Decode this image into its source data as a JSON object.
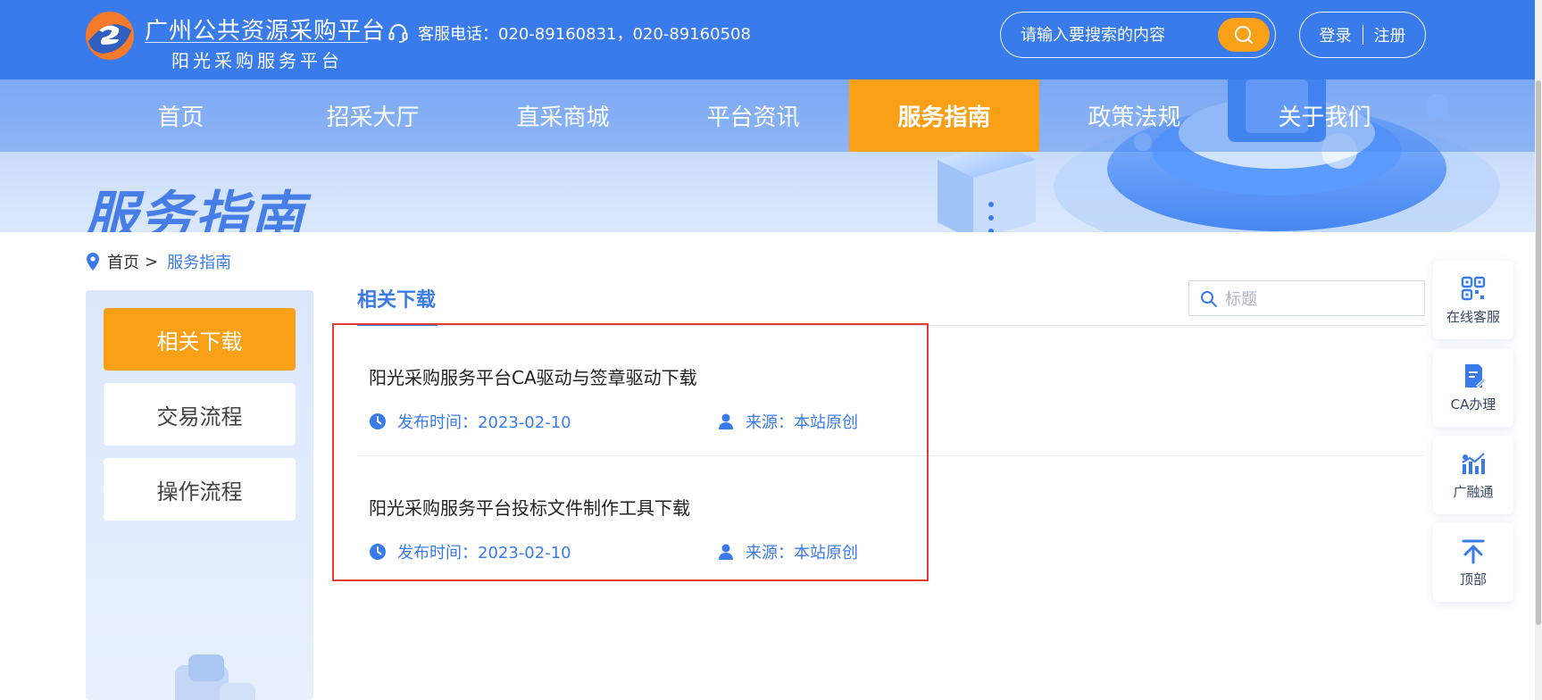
{
  "header": {
    "logo_title": "广州公共资源采购平台",
    "logo_subtitle": "阳光采购服务平台",
    "phone_label": "客服电话：020-89160831，020-89160508",
    "search_placeholder": "请输入要搜索的内容",
    "login": "登录",
    "register": "注册"
  },
  "nav": {
    "items": [
      "首页",
      "招采大厅",
      "直采商城",
      "平台资讯",
      "服务指南",
      "政策法规",
      "关于我们"
    ],
    "active_index": 4
  },
  "banner": {
    "title": "服务指南"
  },
  "breadcrumb": {
    "home": "首页",
    "separator": ">",
    "current": "服务指南"
  },
  "sidebar": {
    "items": [
      "相关下载",
      "交易流程",
      "操作流程"
    ],
    "active_index": 0
  },
  "content": {
    "tab_title": "相关下载",
    "filter_placeholder": "标题",
    "items": [
      {
        "title": "阳光采购服务平台CA驱动与签章驱动下载",
        "date": "发布时间：2023-02-10",
        "source": "来源：本站原创"
      },
      {
        "title": "阳光采购服务平台投标文件制作工具下载",
        "date": "发布时间：2023-02-10",
        "source": "来源：本站原创"
      }
    ]
  },
  "tools": {
    "online_service": "在线客服",
    "ca": "CA办理",
    "finance": "广融通",
    "top": "顶部"
  },
  "colors": {
    "primary": "#3a7bec",
    "accent": "#f9a016",
    "highlight_border": "#e53a3a"
  }
}
